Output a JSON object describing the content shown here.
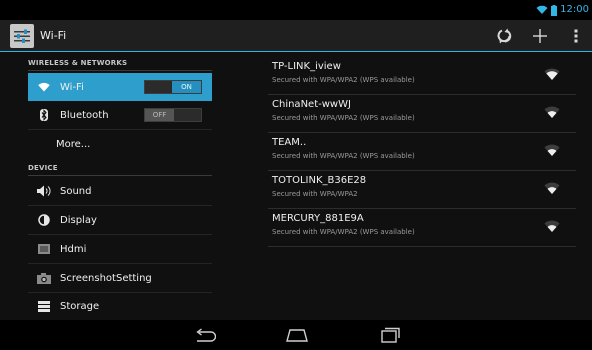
{
  "status_bar": {
    "time": "12:00"
  },
  "action_bar": {
    "title": "Wi-Fi"
  },
  "sidebar": {
    "wireless_header": "WIRELESS & NETWORKS",
    "device_header": "DEVICE",
    "items": [
      {
        "label": "Wi-Fi",
        "icon": "wifi-icon",
        "selected": true,
        "toggle": "ON"
      },
      {
        "label": "Bluetooth",
        "icon": "bluetooth-icon",
        "toggle": "OFF"
      },
      {
        "label": "More..."
      },
      {
        "label": "Sound",
        "icon": "speaker-icon"
      },
      {
        "label": "Display",
        "icon": "brightness-icon"
      },
      {
        "label": "Hdmi",
        "icon": "hdmi-icon"
      },
      {
        "label": "ScreenshotSetting",
        "icon": "camera-icon"
      },
      {
        "label": "Storage",
        "icon": "storage-icon"
      }
    ]
  },
  "networks": [
    {
      "name": "TP-LINK_iview",
      "security": "Secured with WPA/WPA2 (WPS available)",
      "signal": 0.75
    },
    {
      "name": "ChinaNet-wwWJ",
      "security": "Secured with WPA/WPA2 (WPS available)",
      "signal": 0.5
    },
    {
      "name": "TEAM..",
      "security": "Secured with WPA/WPA2 (WPS available)",
      "signal": 0.5
    },
    {
      "name": "TOTOLINK_B36E28",
      "security": "Secured with WPA/WPA2",
      "signal": 0.5
    },
    {
      "name": "MERCURY_881E9A",
      "security": "Secured with WPA/WPA2 (WPS available)",
      "signal": 0.5
    }
  ],
  "colors": {
    "accent": "#33b5e5",
    "selected": "#2e9fcc",
    "background": "#101010"
  },
  "icons": {
    "action_bar": [
      "settings-app-icon",
      "wps-icon",
      "add-network-icon",
      "overflow-menu-icon"
    ],
    "navigation": [
      "back-icon",
      "home-icon",
      "recent-apps-icon"
    ]
  }
}
